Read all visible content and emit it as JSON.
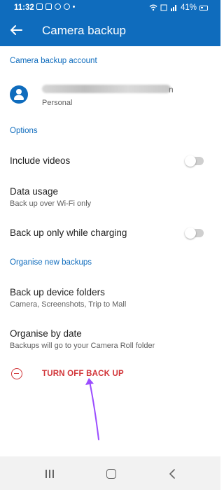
{
  "status_bar": {
    "time": "11:32",
    "battery": "41%",
    "icons": [
      "gallery-icon",
      "message-icon",
      "whatsapp-icon",
      "cloud-icon",
      "dot-icon",
      "wifi-icon",
      "volte-icon",
      "signal-icon",
      "battery-icon"
    ]
  },
  "header": {
    "title": "Camera backup",
    "back_icon": "arrow-left-icon",
    "background": "#0f6cbd"
  },
  "account": {
    "section_label": "Camera backup account",
    "email_visible_tail": "n",
    "account_type": "Personal"
  },
  "options": {
    "section_label": "Options",
    "include_videos": {
      "label": "Include videos",
      "enabled": false
    },
    "data_usage": {
      "label": "Data usage",
      "sub": "Back up over Wi-Fi only"
    },
    "charging": {
      "label": "Back up only while charging",
      "enabled": false
    }
  },
  "organise": {
    "section_label": "Organise new backups",
    "device_folders": {
      "label": "Back up device folders",
      "sub": "Camera, Screenshots, Trip to Mall"
    },
    "by_date": {
      "label": "Organise by date",
      "sub": "Backups will go to your Camera Roll folder"
    }
  },
  "turn_off": {
    "label": "TURN OFF BACK UP",
    "color": "#d13438"
  },
  "annotation": {
    "arrow_color": "#9b4dff"
  },
  "nav": {
    "icons": [
      "recent-apps-icon",
      "home-icon",
      "back-icon"
    ]
  }
}
